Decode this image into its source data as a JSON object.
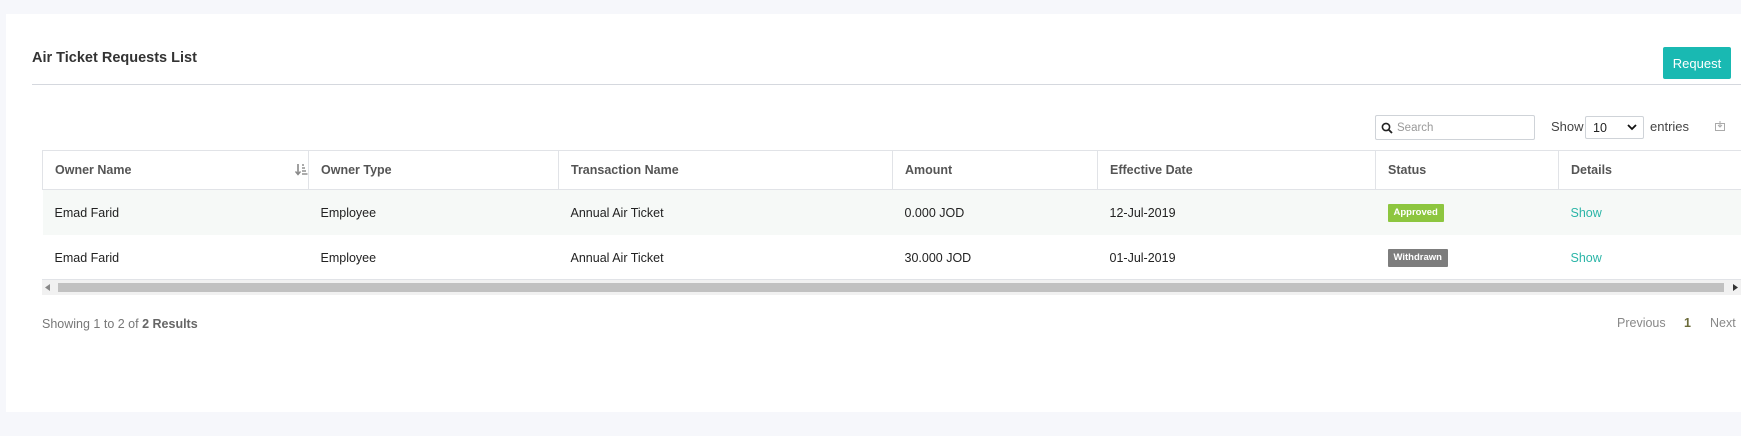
{
  "header": {
    "title": "Air Ticket Requests List",
    "request_button": "Request"
  },
  "controls": {
    "search_placeholder": "Search",
    "show_label": "Show",
    "page_length": "10",
    "entries_label": "entries"
  },
  "table": {
    "columns": [
      "Owner Name",
      "Owner Type",
      "Transaction Name",
      "Amount",
      "Effective Date",
      "Status",
      "Details"
    ],
    "rows": [
      {
        "owner_name": "Emad Farid",
        "owner_type": "Employee",
        "transaction_name": "Annual Air Ticket",
        "amount": "0.000 JOD",
        "effective_date": "12-Jul-2019",
        "status": "Approved",
        "details": "Show"
      },
      {
        "owner_name": "Emad Farid",
        "owner_type": "Employee",
        "transaction_name": "Annual Air Ticket",
        "amount": "30.000 JOD",
        "effective_date": "01-Jul-2019",
        "status": "Withdrawn",
        "details": "Show"
      }
    ]
  },
  "footer": {
    "info_prefix": "Showing 1 to 2 of",
    "info_total": "2 Results",
    "previous": "Previous",
    "current_page": "1",
    "next": "Next"
  },
  "colors": {
    "accent": "#19b9b2",
    "approved": "#8dc63f",
    "withdrawn": "#7d7d7d",
    "link": "#2bb5a7"
  },
  "icons": {
    "search": "search-icon",
    "sort": "sort-icon",
    "export": "export-icon",
    "dropdown": "chevron-down-icon"
  }
}
